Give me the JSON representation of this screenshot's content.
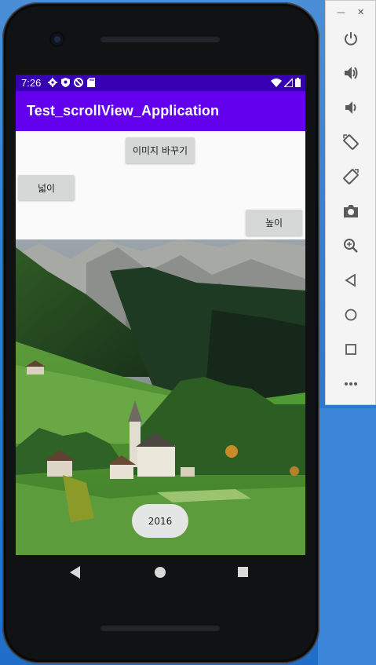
{
  "status_bar": {
    "time": "7:26",
    "left_icons": [
      "settings-icon",
      "shield-icon",
      "block-icon",
      "sd-card-icon"
    ],
    "right_icons": [
      "wifi-icon",
      "signal-icon",
      "battery-icon"
    ]
  },
  "app_bar": {
    "title": "Test_scrollView_Application"
  },
  "buttons": {
    "change_image": "이미지 바꾸기",
    "width": "넓이",
    "height": "높이",
    "year": "2016"
  },
  "system_nav": [
    "back-icon",
    "home-icon",
    "recents-icon"
  ],
  "emulator_panel": {
    "window_controls": [
      "minimize-icon",
      "close-icon"
    ],
    "items": [
      "power-icon",
      "volume-up-icon",
      "volume-down-icon",
      "rotate-left-icon",
      "rotate-right-icon",
      "camera-icon",
      "zoom-icon",
      "back-icon",
      "home-icon",
      "overview-icon",
      "more-icon"
    ]
  },
  "colors": {
    "status_bar": "#3700b3",
    "app_bar": "#6200ee",
    "button": "#d6d7d7",
    "screen_bg": "#fafafa"
  }
}
